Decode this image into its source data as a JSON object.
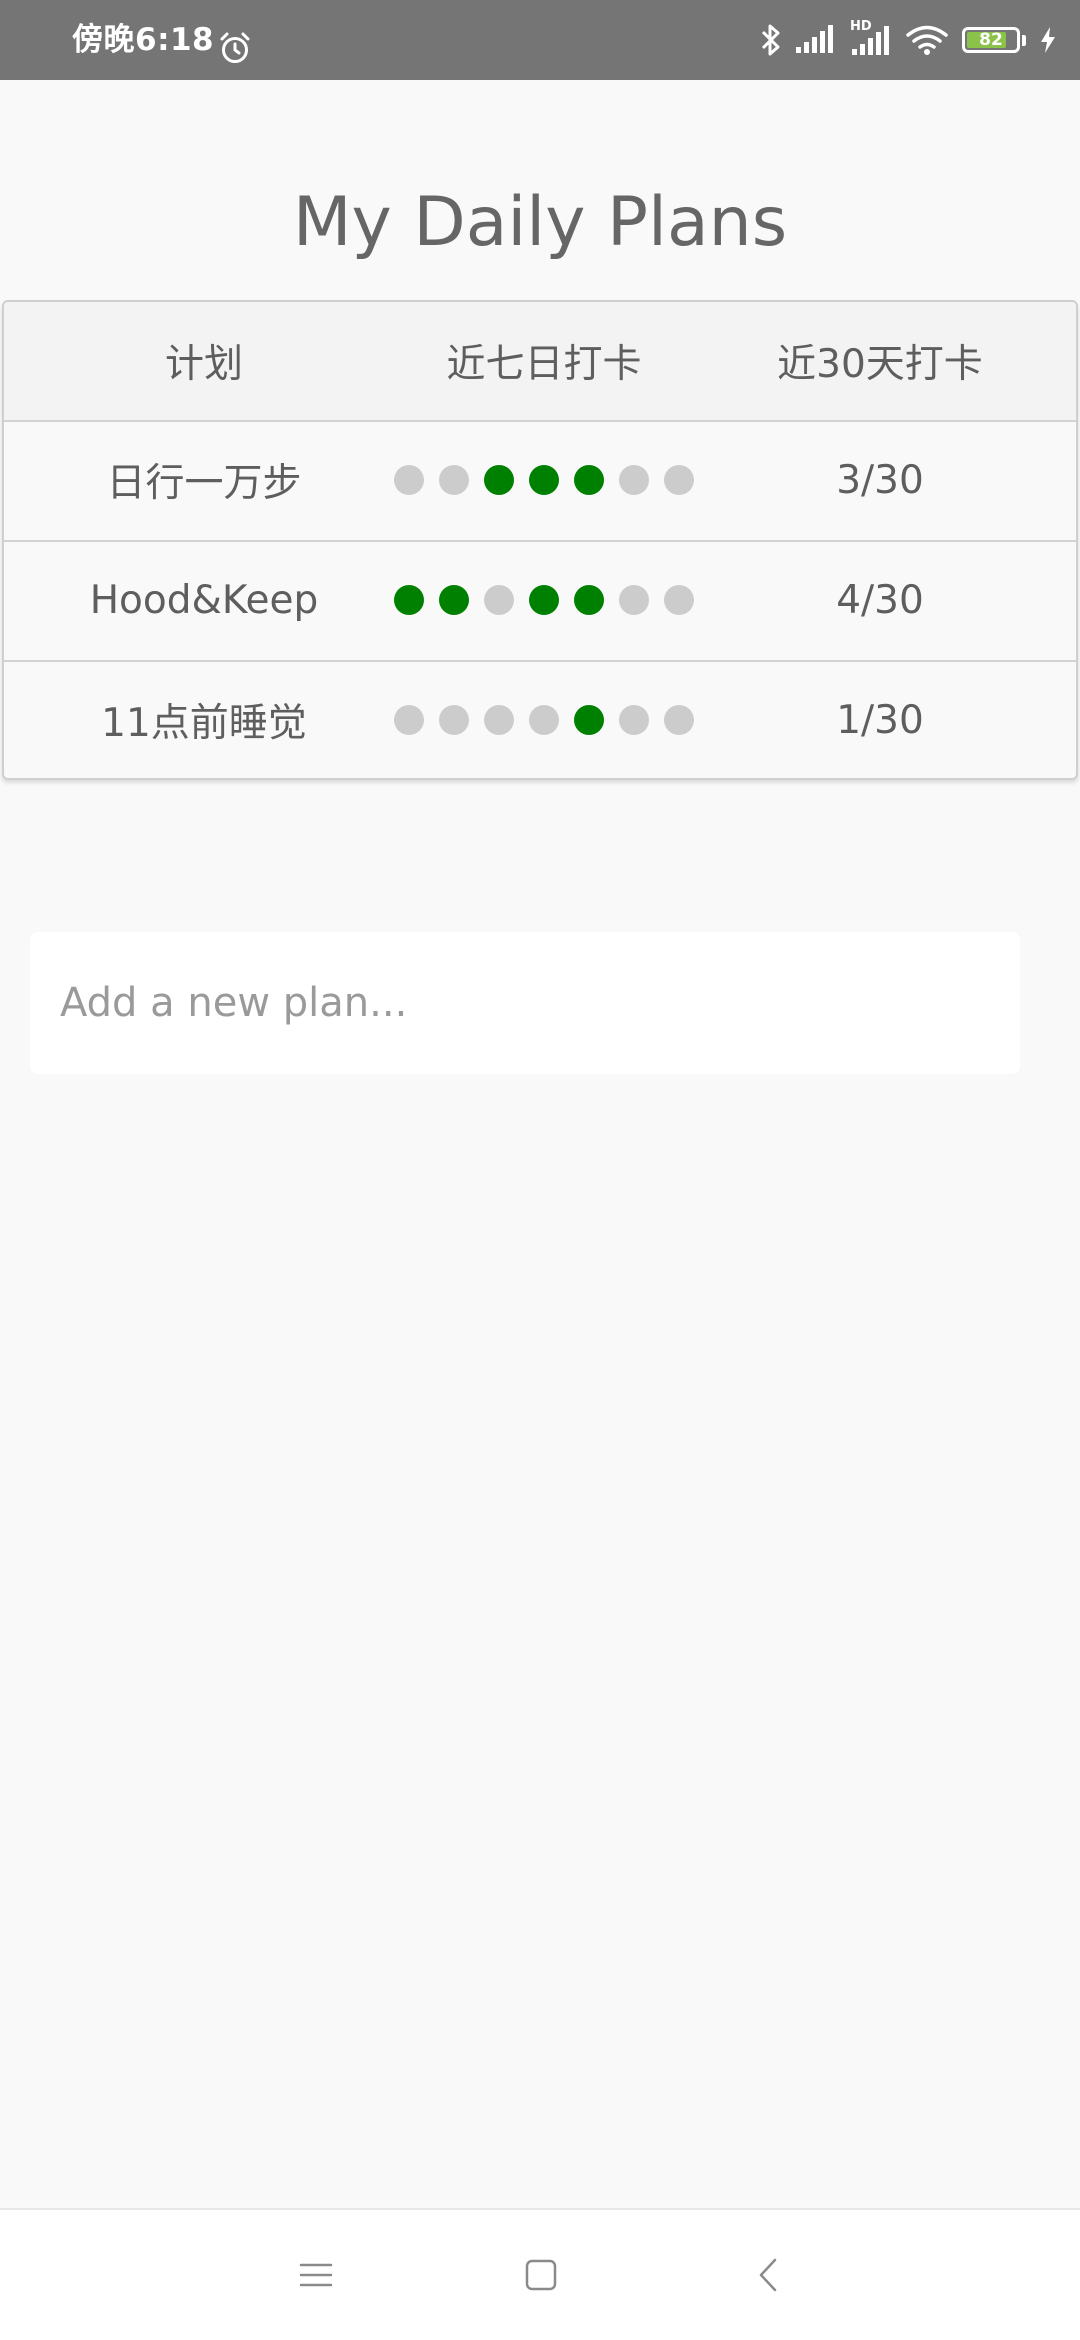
{
  "status_bar": {
    "time": "傍晚6:18",
    "battery": 82,
    "battery_label": "82",
    "hd_label": "HD",
    "icons": [
      "alarm-icon",
      "bluetooth-icon",
      "signal-icon",
      "signal-hd-icon",
      "wifi-icon",
      "battery-icon",
      "charging-icon"
    ]
  },
  "app": {
    "title": "My Daily Plans"
  },
  "table": {
    "headers": {
      "plan": "计划",
      "last7": "近七日打卡",
      "last30": "近30天打卡"
    },
    "rows": [
      {
        "name": "日行一万步",
        "checks": [
          false,
          false,
          true,
          true,
          true,
          false,
          false
        ],
        "count": "3/30"
      },
      {
        "name": "Hood&Keep",
        "checks": [
          true,
          true,
          false,
          true,
          true,
          false,
          false
        ],
        "count": "4/30"
      },
      {
        "name": "11点前睡觉",
        "checks": [
          false,
          false,
          false,
          false,
          true,
          false,
          false
        ],
        "count": "1/30"
      }
    ]
  },
  "input": {
    "placeholder": "Add a new plan..."
  },
  "colors": {
    "checked": "#008000",
    "unchecked": "#cccccc",
    "status_bar": "#757575",
    "battery": "#8bc34a"
  },
  "nav": {
    "icons": [
      "menu-icon",
      "home-icon",
      "back-icon"
    ]
  }
}
